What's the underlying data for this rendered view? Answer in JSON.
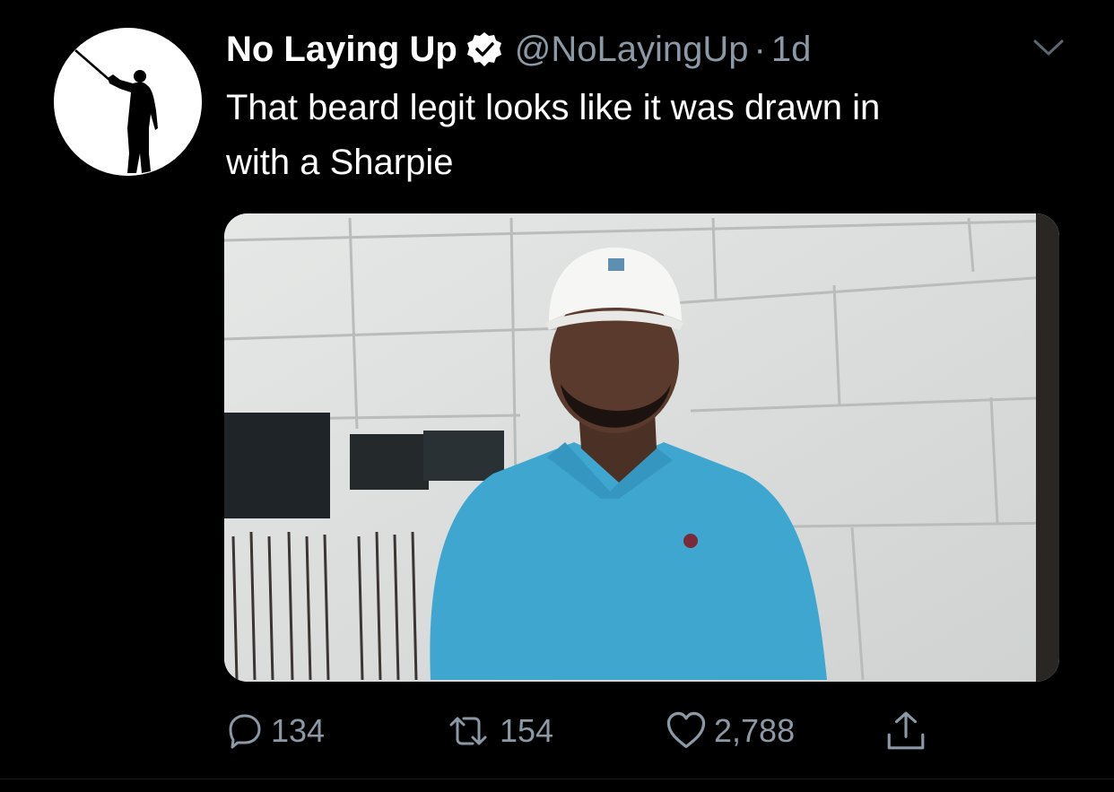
{
  "tweet": {
    "author_name": "No Laying Up",
    "handle": "@NoLayingUp",
    "separator": "·",
    "time": "1d",
    "text_line1": "That beard legit looks like it was drawn in",
    "text_line2": "with a Sharpie",
    "verified": true
  },
  "icons": {
    "avatar": "golfer-silhouette-avatar",
    "verified": "verified-badge-icon",
    "menu": "chevron-down-icon",
    "reply": "reply-icon",
    "retweet": "retweet-icon",
    "like": "heart-icon",
    "share": "share-icon"
  },
  "actions": {
    "replies": "134",
    "retweets": "154",
    "likes": "2,788"
  },
  "colors": {
    "background": "#000000",
    "primary_text": "#ffffff",
    "secondary_text": "#8b98a5",
    "verified_badge": "#ffffff"
  }
}
